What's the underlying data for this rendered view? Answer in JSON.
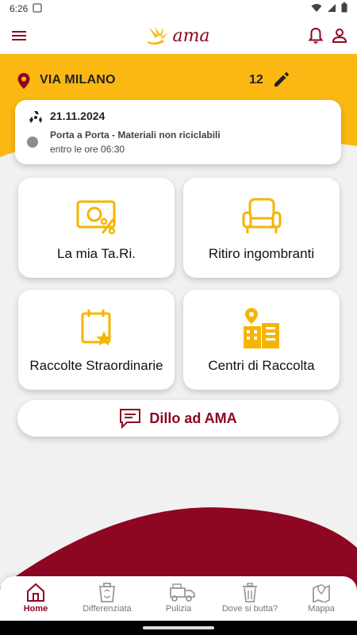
{
  "status_bar": {
    "time": "6:26"
  },
  "header": {
    "logo_text": "ama"
  },
  "location": {
    "street": "VIA MILANO",
    "civic": "12"
  },
  "next_collection": {
    "date": "21.11.2024",
    "type": "Porta a Porta - Materiali non riciclabili",
    "deadline": "entro le ore 06:30"
  },
  "tiles": [
    {
      "label": "La mia Ta.Ri."
    },
    {
      "label": "Ritiro ingombranti"
    },
    {
      "label": "Raccolte Straordinarie"
    },
    {
      "label": "Centri di Raccolta"
    }
  ],
  "dillo": {
    "label": "Dillo ad AMA"
  },
  "bottom_nav": [
    {
      "label": "Home",
      "active": true
    },
    {
      "label": "Differenziata"
    },
    {
      "label": "Pulizia"
    },
    {
      "label": "Dove si butta?"
    },
    {
      "label": "Mappa"
    }
  ],
  "colors": {
    "brand_maroon": "#8d0723",
    "brand_yellow": "#fbb812",
    "icon_yellow": "#f6b400"
  }
}
